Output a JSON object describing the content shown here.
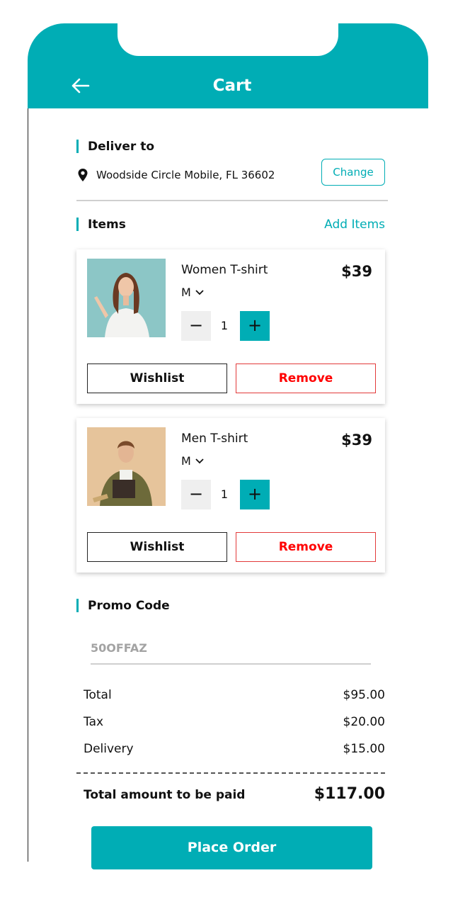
{
  "colors": {
    "accent": "#00adb5",
    "remove": "#ff0000",
    "text": "#111111"
  },
  "header": {
    "title": "Cart",
    "back_icon": "arrow-left-icon"
  },
  "deliver": {
    "label": "Deliver to",
    "address": "Woodside Circle Mobile, FL 36602",
    "location_icon": "location-pin-icon",
    "change_label": "Change"
  },
  "items_section": {
    "label": "Items",
    "add_label": "Add Items"
  },
  "items": [
    {
      "name": "Women T-shirt",
      "size": "M",
      "quantity": "1",
      "price": "$39",
      "minus": "−",
      "plus": "+",
      "wishlist": "Wishlist",
      "remove": "Remove"
    },
    {
      "name": "Men T-shirt",
      "size": "M",
      "quantity": "1",
      "price": "$39",
      "minus": "−",
      "plus": "+",
      "wishlist": "Wishlist",
      "remove": "Remove"
    }
  ],
  "promo": {
    "label": "Promo Code",
    "placeholder": "50OFFAZ"
  },
  "summary": {
    "total_label": "Total",
    "total_value": "$95.00",
    "tax_label": "Tax",
    "tax_value": "$20.00",
    "delivery_label": "Delivery",
    "delivery_value": "$15.00",
    "grand_label": "Total amount to be paid",
    "grand_value": "$117.00"
  },
  "place_order_label": "Place Order"
}
